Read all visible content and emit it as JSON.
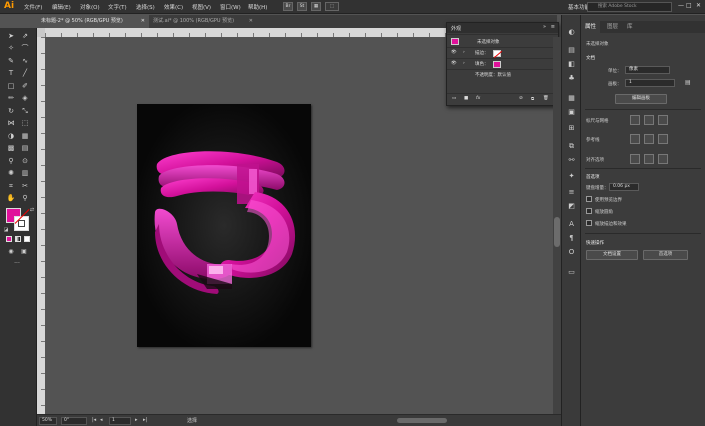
{
  "app": {
    "logo": "Ai"
  },
  "menu": [
    "文件(F)",
    "编辑(E)",
    "对象(O)",
    "文字(T)",
    "选择(S)",
    "效果(C)",
    "视图(V)",
    "窗口(W)",
    "帮助(H)"
  ],
  "toolbar_squares": [
    "Br",
    "St"
  ],
  "workspace": "基本功能",
  "search_placeholder": "搜索 Adobe Stock",
  "window_controls": {
    "minimize": "—",
    "maximize": "□",
    "close": "✕"
  },
  "tabs": [
    {
      "label": "未标题-2* @ 50% (RGB/GPU 预览)",
      "close": "✕"
    },
    {
      "label": "测试.ai* @ 100% (RGB/GPU 预览)",
      "close": "✕"
    }
  ],
  "status": {
    "zoom": "50%",
    "angle": "0°",
    "page": "1",
    "mode": "选择"
  },
  "colors": {
    "fill": "#e0129b",
    "accent": "#ff9a00"
  },
  "appearance": {
    "title": "外观",
    "object_label": "未选择对象",
    "stroke_label": "描边：",
    "fill_label": "填色：",
    "opacity_label": "不透明度：默认值",
    "footer_icons": [
      "new-stroke-icon",
      "new-fill-icon",
      "fx-icon",
      "clear-icon",
      "duplicate-icon",
      "delete-icon"
    ],
    "fx": "fx"
  },
  "properties": {
    "tabs": [
      "属性",
      "图层",
      "库"
    ],
    "no_selection": "未选择对象",
    "document": "文档",
    "units_label": "单位：",
    "units_value": "像素",
    "artboard_label": "画板：",
    "artboard_value": "1",
    "edit_artboard": "编辑画板",
    "rulers_grids": "标尺与网格",
    "guides": "参考线",
    "align_to": "对齐选项",
    "preferences": "首选项",
    "keyboard_increment_label": "键盘增量：",
    "keyboard_increment_value": "0.06 px",
    "checkbox_preview_bounds": "使用预览边界",
    "checkbox_scale_corners": "缩放圆角",
    "checkbox_scale_strokes": "缩放描边和效果",
    "quick_actions": "快速操作",
    "doc_setup": "文档设置",
    "preferences_btn": "首选项"
  }
}
